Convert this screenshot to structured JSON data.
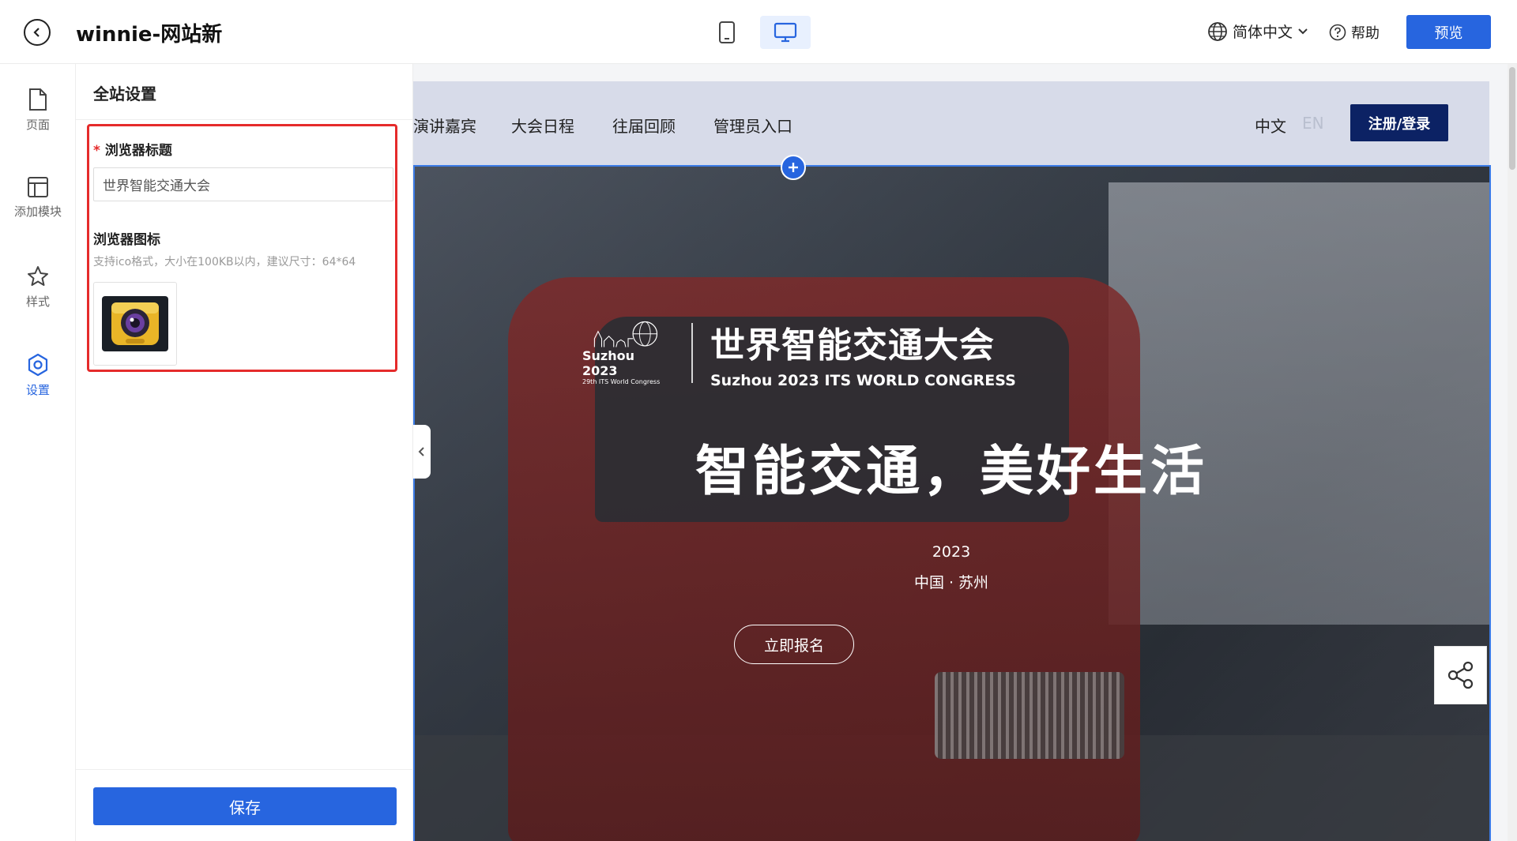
{
  "header": {
    "site_name": "winnie-网站新",
    "language": "简体中文",
    "help_label": "帮助",
    "preview_label": "预览"
  },
  "rail": {
    "items": [
      {
        "label": "页面",
        "icon": "page-icon"
      },
      {
        "label": "添加模块",
        "icon": "layout-icon"
      },
      {
        "label": "样式",
        "icon": "style-icon"
      },
      {
        "label": "设置",
        "icon": "settings-icon",
        "active": true
      }
    ]
  },
  "panel": {
    "title": "全站设置",
    "browser_title_label": "浏览器标题",
    "browser_title_value": "世界智能交通大会",
    "browser_icon_label": "浏览器图标",
    "browser_icon_hint": "支持ico格式，大小在100KB以内，建议尺寸：64*64",
    "save_label": "保存"
  },
  "site": {
    "nav": [
      "演讲嘉宾",
      "大会日程",
      "往届回顾",
      "管理员入口"
    ],
    "lang_zh": "中文",
    "lang_en": "EN",
    "login_label": "注册/登录",
    "logo_city": "Suzhou 2023",
    "logo_sub": "29th ITS World Congress",
    "congress_cn": "世界智能交通大会",
    "congress_en": "Suzhou 2023 ITS WORLD CONGRESS",
    "slogan": "智能交通，美好生活",
    "year": "2023",
    "place": "中国 · 苏州",
    "register_label": "立即报名"
  },
  "colors": {
    "primary": "#2765df",
    "highlight": "#e52b2b",
    "login_bg": "#0c2264",
    "nav_bg": "#d7dbe9"
  }
}
